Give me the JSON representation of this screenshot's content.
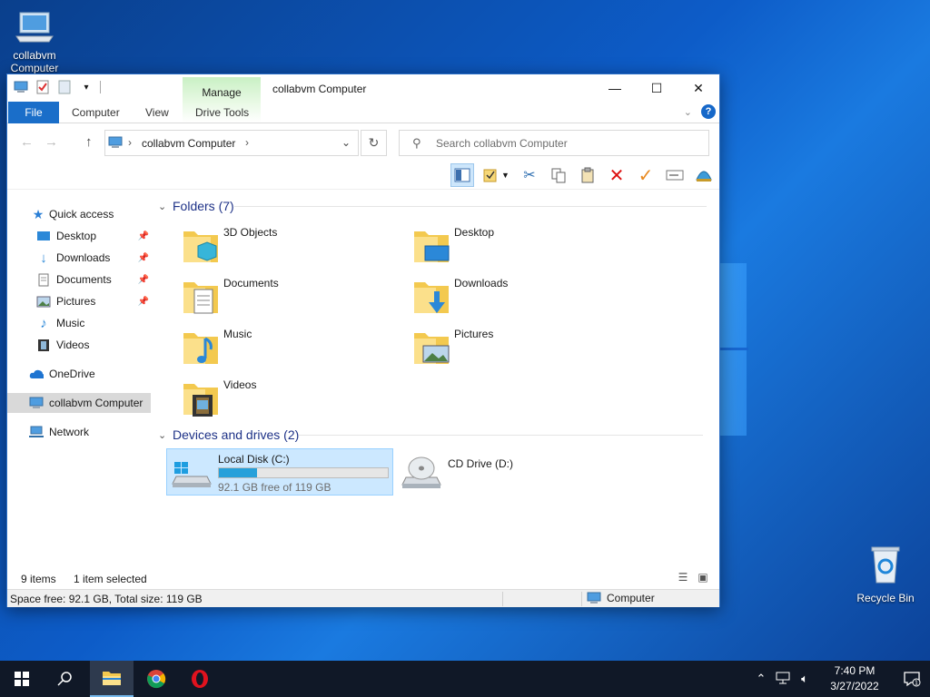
{
  "desktop": {
    "icons": [
      {
        "label": "collabvm Computer",
        "icon": "computer-icon"
      },
      {
        "label": "Recycle Bin",
        "icon": "recycle-bin-icon"
      }
    ]
  },
  "window": {
    "title": "collabvm Computer",
    "manage_tab": "Manage",
    "ribbon_tabs": [
      "File",
      "Computer",
      "View",
      "Drive Tools"
    ],
    "address": {
      "crumb": "collabvm Computer"
    },
    "search": {
      "placeholder": "Search collabvm Computer"
    },
    "nav": {
      "quick_access": "Quick access",
      "items": [
        "Desktop",
        "Downloads",
        "Documents",
        "Pictures",
        "Music",
        "Videos"
      ],
      "onedrive": "OneDrive",
      "computer": "collabvm Computer",
      "network": "Network"
    },
    "folders_header": "Folders (7)",
    "folders": [
      "3D Objects",
      "Desktop",
      "Documents",
      "Downloads",
      "Music",
      "Pictures",
      "Videos"
    ],
    "drives_header": "Devices and drives (2)",
    "drives": [
      {
        "name": "Local Disk (C:)",
        "info": "92.1 GB free of 119 GB",
        "used_fraction": 0.226
      },
      {
        "name": "CD Drive (D:)"
      }
    ],
    "status": {
      "items": "9 items",
      "selected": "1 item selected",
      "space": "Space free: 92.1 GB, Total size: 119 GB",
      "location": "Computer"
    }
  },
  "taskbar": {
    "time": "7:40 PM",
    "date": "3/27/2022",
    "notifications": "1"
  },
  "colors": {
    "accent": "#1a6ec9",
    "selection": "#cce8ff",
    "taskbar": "#101827"
  }
}
